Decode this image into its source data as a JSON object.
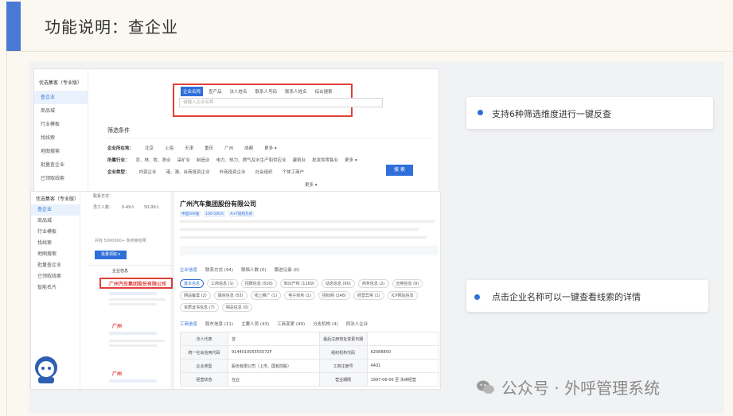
{
  "slide": {
    "title": "功能说明：查企业"
  },
  "callouts": [
    {
      "text": "支持6种筛选维度进行一键反查"
    },
    {
      "text": "点击企业名称可以一键查看线索的详情"
    }
  ],
  "watermark": {
    "text": "公众号 · 外呼管理系统"
  },
  "shot1": {
    "sidebar": {
      "header": "优选集客（专业版）",
      "items": [
        {
          "label": "查企业",
          "active": true
        },
        {
          "label": "商品城"
        },
        {
          "label": "行业模板"
        },
        {
          "label": "找线索"
        },
        {
          "label": "地图搜索"
        },
        {
          "label": "批量查企业"
        },
        {
          "label": "已领取线索"
        }
      ]
    },
    "search": {
      "tabs": [
        "企业名称",
        "查产品",
        "法人姓名",
        "联系人号码",
        "联系人姓名",
        "综合搜索"
      ],
      "placeholder": "请输入企业名称",
      "button": "搜 索"
    },
    "filters": {
      "title": "筛选条件",
      "region_label": "企业所在地：",
      "regions": [
        "北京",
        "上海",
        "天津",
        "重庆",
        "广州",
        "成都",
        "更多 ▾"
      ],
      "industry_label": "所属行业：",
      "industries": [
        "农、林、牧、渔业",
        "采矿业",
        "制造业",
        "电力、热力、燃气及水生产和供应业",
        "建筑业",
        "批发和零售业",
        "更多 ▾"
      ],
      "type_label": "企业类型：",
      "types": [
        "内资企业",
        "港、澳、台商投资企业",
        "外商投资企业",
        "社会组织",
        "个体工商户"
      ],
      "more": "更多 ▾"
    }
  },
  "shot2": {
    "sidebar": {
      "header": "优选集客（专业版）",
      "items": [
        "查企业",
        "商品城",
        "行业模板",
        "找线索",
        "地图搜索",
        "批量查企业",
        "已领取线索",
        "智能名片"
      ]
    },
    "list": {
      "contact_label": "联系方式：",
      "staff_label": "员工人数：",
      "staff_values": [
        "0-49人",
        "50-99人"
      ],
      "result_text": "共有 5000000+ 条搜索结果",
      "batch_button": "批量领取 ▾",
      "column_header": "企业信息",
      "company_highlight": "广州汽车集团股份有限公司",
      "company_2": "广州",
      "company_3": "广州"
    },
    "detail": {
      "title": "广州汽车集团股份有限公司",
      "tags": [
        "中国500强",
        "100-500人",
        "A+T级别方式"
      ],
      "top_tabs": [
        "企业信息",
        "联系方式 (94)",
        "联络人数 (0)",
        "跟进记录 (0)"
      ],
      "pills": [
        "基本信息",
        "工商信息 (1)",
        "招聘信息 (500)",
        "知识产权 (1169)",
        "动态信息 (60)",
        "商务信息 (2)",
        "应用信息 (9)",
        "网站备案 (2)",
        "融资信息 (53)",
        "线上推广 (1)",
        "电子商务 (1)",
        "招标网 (248)",
        "经营异常 (1)",
        "ICP网站信息",
        "资质证书信息 (7)",
        "相关信息 (0)"
      ],
      "section_tabs": [
        "工商信息",
        "股东信息 (11)",
        "主要人员 (43)",
        "工商变更 (49)",
        "分支机构 (4)",
        "同法人企业"
      ],
      "table": [
        [
          "法人代表",
          "曾",
          "最后注册地址变更日期",
          ""
        ],
        [
          "统一社会信用代码",
          "914401005555572F",
          "组织机构代码",
          "62088850"
        ],
        [
          "企业类型",
          "股份有限公司（上市、国有控股）",
          "工商注册号",
          "4401"
        ],
        [
          "经营状态",
          "在业",
          "营业期限",
          "1997-06-06 至 永续经营"
        ]
      ]
    }
  }
}
